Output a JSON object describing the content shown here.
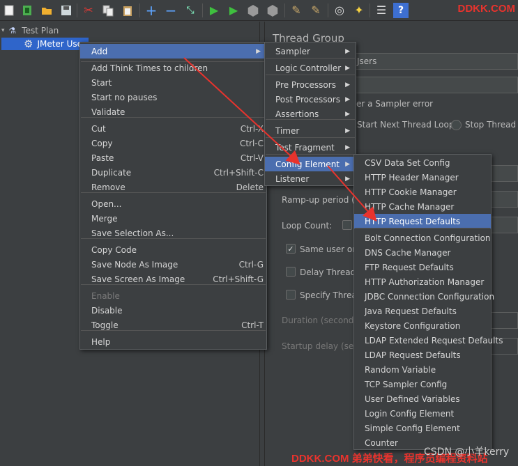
{
  "brand": "DDKK.COM",
  "toolbar_icons": [
    "new-icon",
    "templates-icon",
    "open-icon",
    "save-icon",
    "cut-icon",
    "copy-icon",
    "paste-icon",
    "expand-icon",
    "collapse-icon",
    "toggle-icon",
    "start-icon",
    "start-no-pauses-icon",
    "stop-icon",
    "shutdown-icon",
    "clear-icon",
    "clear-all-icon",
    "search-icon",
    "reset-search-icon",
    "function-helper-icon",
    "help-icon"
  ],
  "tree": {
    "root": "Test Plan",
    "child": "JMeter Use"
  },
  "panel": {
    "title": "Thread Group",
    "users_suffix": "Jsers",
    "sampler_error": "er a Sampler error",
    "start_next": "Start Next Thread Loop",
    "stop_thread": "Stop Thread",
    "ramp_up": "Ramp-up period (se",
    "loop_count": "Loop Count:",
    "same_user": "Same user on",
    "delay_thread": "Delay Thread c",
    "specify_thread": "Specify Thread",
    "duration": "Duration (seconds)",
    "startup_delay": "Startup delay (seco"
  },
  "menu1": {
    "add": "Add",
    "items": [
      {
        "label": "Add Think Times to children",
        "shortcut": ""
      },
      {
        "label": "Start",
        "shortcut": ""
      },
      {
        "label": "Start no pauses",
        "shortcut": ""
      },
      {
        "label": "Validate",
        "shortcut": ""
      },
      {
        "label": "Cut",
        "shortcut": "Ctrl-X"
      },
      {
        "label": "Copy",
        "shortcut": "Ctrl-C"
      },
      {
        "label": "Paste",
        "shortcut": "Ctrl-V"
      },
      {
        "label": "Duplicate",
        "shortcut": "Ctrl+Shift-C"
      },
      {
        "label": "Remove",
        "shortcut": "Delete"
      },
      {
        "label": "Open...",
        "shortcut": ""
      },
      {
        "label": "Merge",
        "shortcut": ""
      },
      {
        "label": "Save Selection As...",
        "shortcut": ""
      },
      {
        "label": "Copy Code",
        "shortcut": ""
      },
      {
        "label": "Save Node As Image",
        "shortcut": "Ctrl-G"
      },
      {
        "label": "Save Screen As Image",
        "shortcut": "Ctrl+Shift-G"
      },
      {
        "label": "Enable",
        "shortcut": ""
      },
      {
        "label": "Disable",
        "shortcut": ""
      },
      {
        "label": "Toggle",
        "shortcut": "Ctrl-T"
      },
      {
        "label": "Help",
        "shortcut": ""
      }
    ]
  },
  "menu2": {
    "items": [
      "Sampler",
      "Logic Controller",
      "Pre Processors",
      "Post Processors",
      "Assertions",
      "Timer",
      "Test Fragment",
      "Config Element",
      "Listener"
    ]
  },
  "menu3": {
    "items": [
      "CSV Data Set Config",
      "HTTP Header Manager",
      "HTTP Cookie Manager",
      "HTTP Cache Manager",
      "HTTP Request Defaults",
      "Bolt Connection Configuration",
      "DNS Cache Manager",
      "FTP Request Defaults",
      "HTTP Authorization Manager",
      "JDBC Connection Configuration",
      "Java Request Defaults",
      "Keystore Configuration",
      "LDAP Extended Request Defaults",
      "LDAP Request Defaults",
      "Random Variable",
      "TCP Sampler Config",
      "User Defined Variables",
      "Login Config Element",
      "Simple Config Element",
      "Counter"
    ]
  },
  "watermark": "DDKK.COM 弟弟快看，程序员编程资料站",
  "csdn": "CSDN @小羊kerry",
  "colors": {
    "highlight": "#4b6eaf",
    "arrow": "#e8332d",
    "brand": "#e8332d"
  }
}
